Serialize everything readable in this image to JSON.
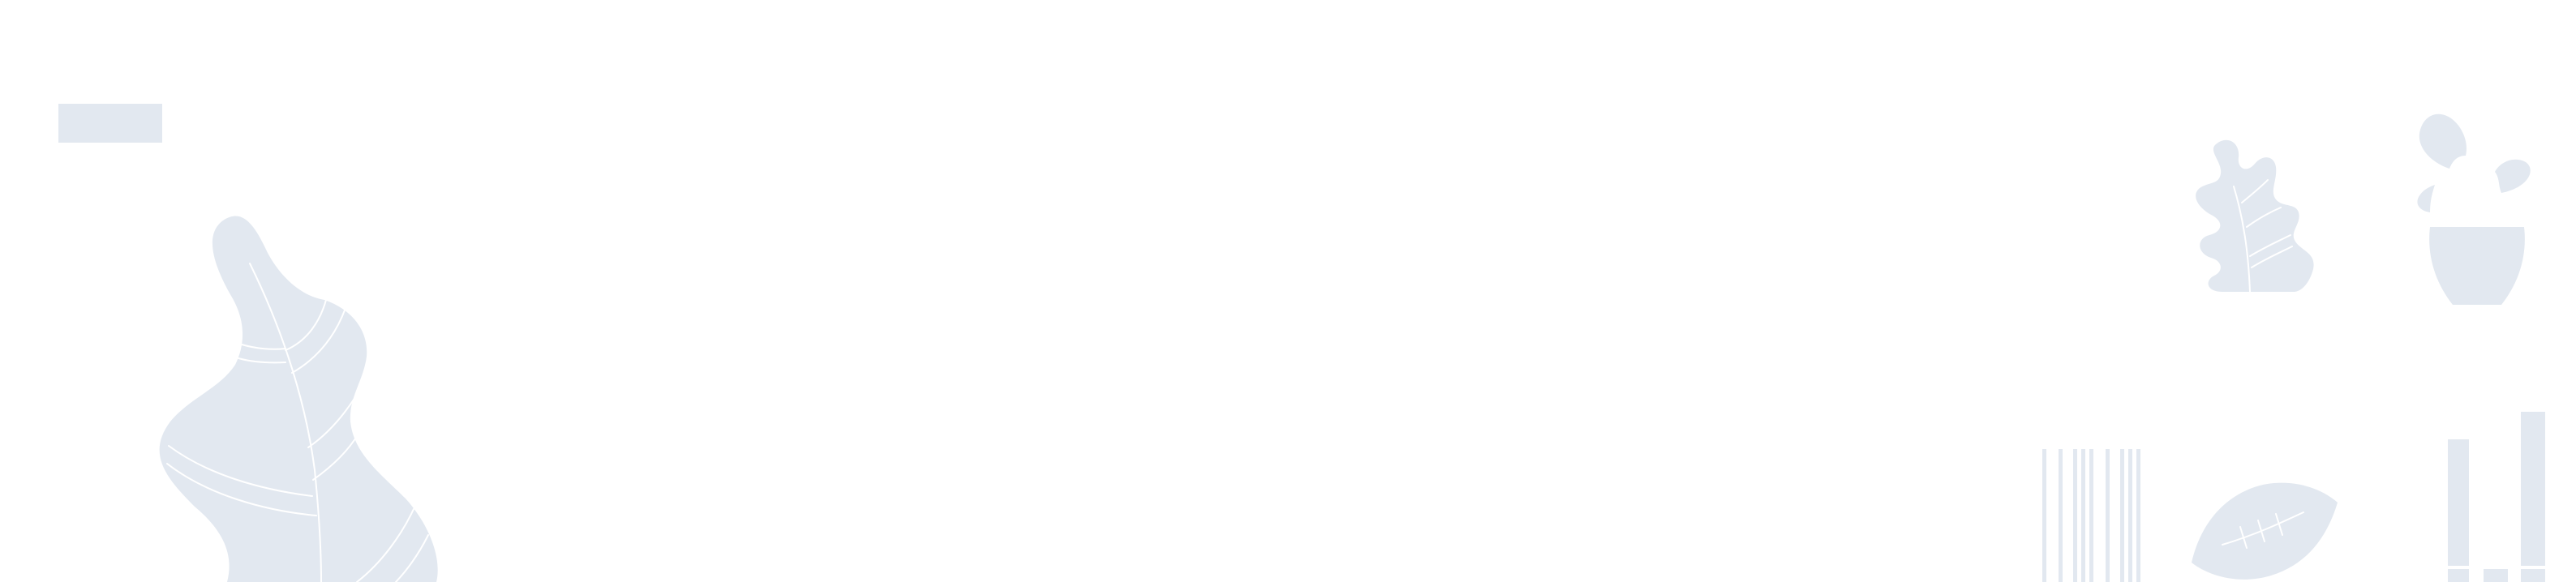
{
  "theme": {
    "background": "#ffffff",
    "shape_color": "#e2e8f0",
    "line_color": "#ffffff"
  },
  "decorations": [
    "placeholder-block",
    "large-leaf-illustration",
    "oak-leaf-sprig-illustration",
    "potted-cactus-illustration",
    "vertical-bars-illustration",
    "small-leaf-illustration",
    "bar-blocks-illustration"
  ]
}
